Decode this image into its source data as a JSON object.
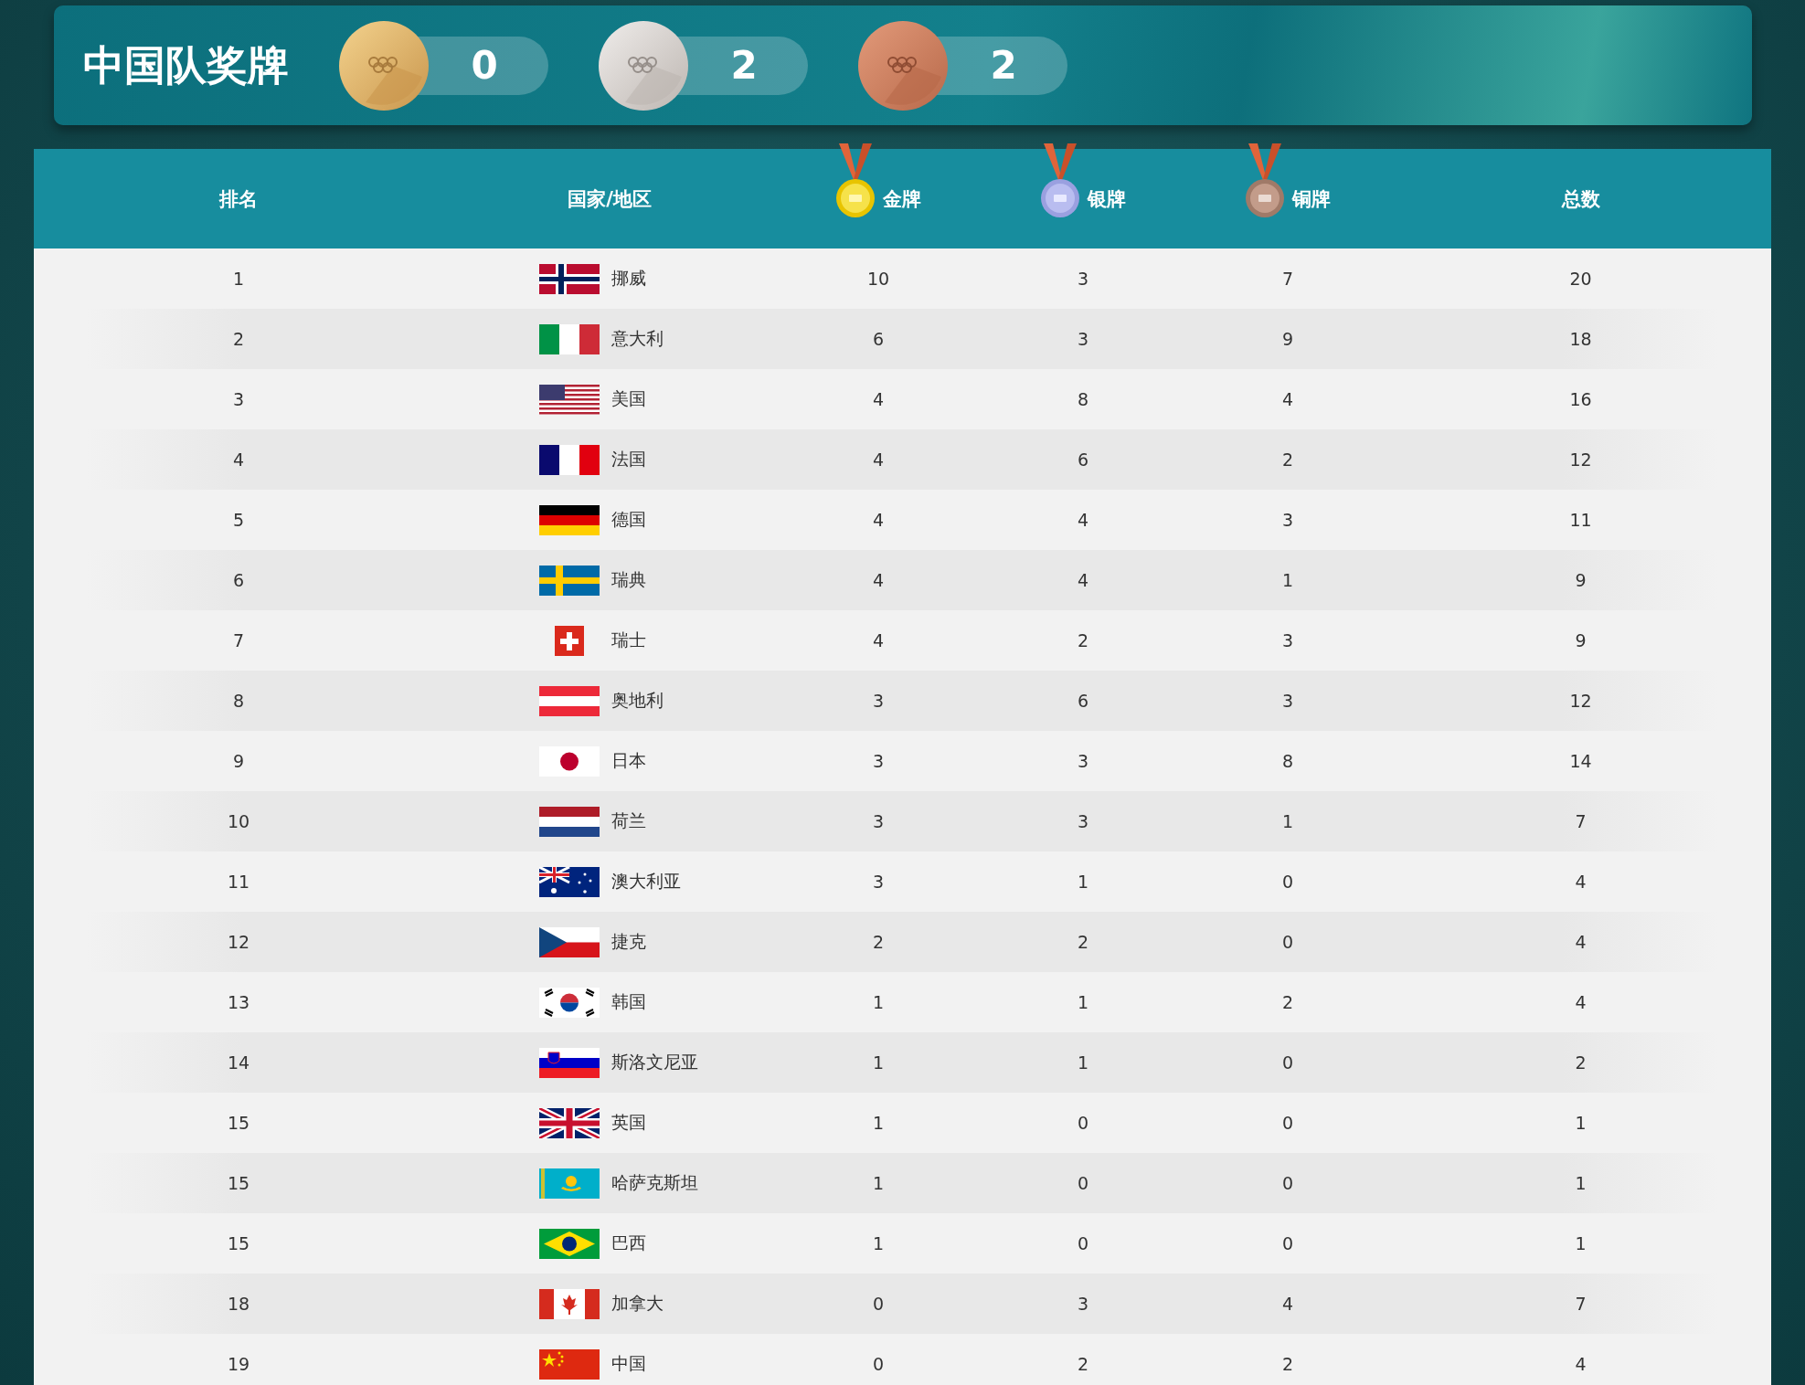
{
  "banner": {
    "title": "中国队奖牌",
    "medals": [
      {
        "kind": "gold",
        "count": "0"
      },
      {
        "kind": "silver",
        "count": "2"
      },
      {
        "kind": "bronze",
        "count": "2"
      }
    ]
  },
  "table": {
    "columns": [
      {
        "kind": "plain",
        "label": "排名"
      },
      {
        "kind": "plain",
        "label": "国家/地区"
      },
      {
        "kind": "gold",
        "label": "金牌"
      },
      {
        "kind": "silver",
        "label": "银牌"
      },
      {
        "kind": "bronze",
        "label": "铜牌"
      },
      {
        "kind": "plain",
        "label": "总数"
      }
    ],
    "rows": [
      {
        "rank": "1",
        "country": "挪威",
        "gold": "10",
        "silver": "3",
        "bronze": "7",
        "total": "20"
      },
      {
        "rank": "2",
        "country": "意大利",
        "gold": "6",
        "silver": "3",
        "bronze": "9",
        "total": "18"
      },
      {
        "rank": "3",
        "country": "美国",
        "gold": "4",
        "silver": "8",
        "bronze": "4",
        "total": "16"
      },
      {
        "rank": "4",
        "country": "法国",
        "gold": "4",
        "silver": "6",
        "bronze": "2",
        "total": "12"
      },
      {
        "rank": "5",
        "country": "德国",
        "gold": "4",
        "silver": "4",
        "bronze": "3",
        "total": "11"
      },
      {
        "rank": "6",
        "country": "瑞典",
        "gold": "4",
        "silver": "4",
        "bronze": "1",
        "total": "9"
      },
      {
        "rank": "7",
        "country": "瑞士",
        "gold": "4",
        "silver": "2",
        "bronze": "3",
        "total": "9"
      },
      {
        "rank": "8",
        "country": "奥地利",
        "gold": "3",
        "silver": "6",
        "bronze": "3",
        "total": "12"
      },
      {
        "rank": "9",
        "country": "日本",
        "gold": "3",
        "silver": "3",
        "bronze": "8",
        "total": "14"
      },
      {
        "rank": "10",
        "country": "荷兰",
        "gold": "3",
        "silver": "3",
        "bronze": "1",
        "total": "7"
      },
      {
        "rank": "11",
        "country": "澳大利亚",
        "gold": "3",
        "silver": "1",
        "bronze": "0",
        "total": "4"
      },
      {
        "rank": "12",
        "country": "捷克",
        "gold": "2",
        "silver": "2",
        "bronze": "0",
        "total": "4"
      },
      {
        "rank": "13",
        "country": "韩国",
        "gold": "1",
        "silver": "1",
        "bronze": "2",
        "total": "4"
      },
      {
        "rank": "14",
        "country": "斯洛文尼亚",
        "gold": "1",
        "silver": "1",
        "bronze": "0",
        "total": "2"
      },
      {
        "rank": "15",
        "country": "英国",
        "gold": "1",
        "silver": "0",
        "bronze": "0",
        "total": "1"
      },
      {
        "rank": "15",
        "country": "哈萨克斯坦",
        "gold": "1",
        "silver": "0",
        "bronze": "0",
        "total": "1"
      },
      {
        "rank": "15",
        "country": "巴西",
        "gold": "1",
        "silver": "0",
        "bronze": "0",
        "total": "1"
      },
      {
        "rank": "18",
        "country": "加拿大",
        "gold": "0",
        "silver": "3",
        "bronze": "4",
        "total": "7"
      },
      {
        "rank": "19",
        "country": "中国",
        "gold": "0",
        "silver": "2",
        "bronze": "2",
        "total": "4"
      }
    ]
  }
}
